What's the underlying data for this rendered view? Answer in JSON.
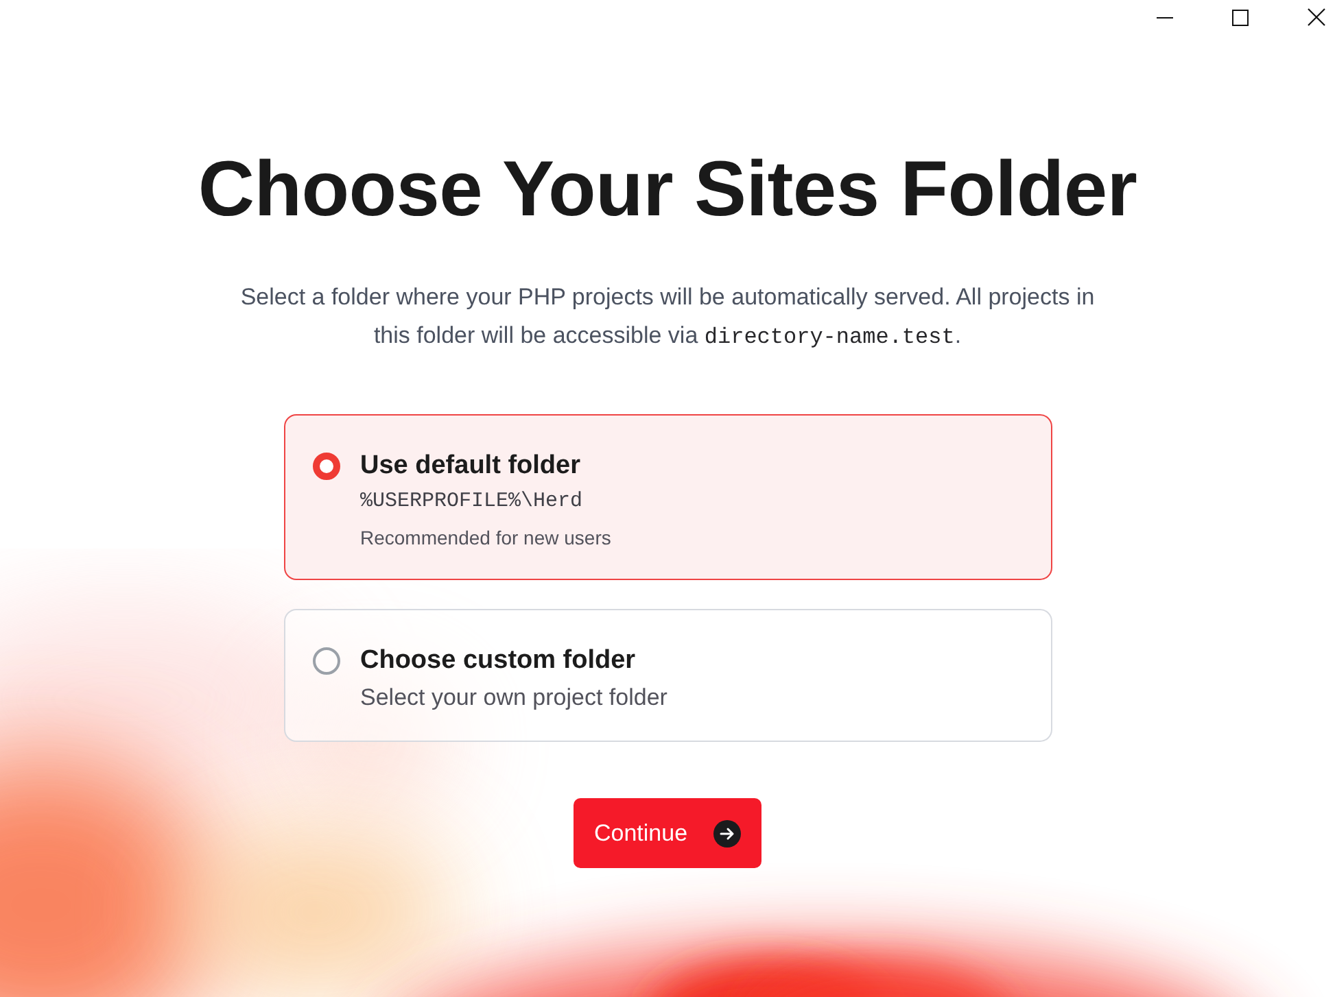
{
  "title": "Choose Your Sites Folder",
  "description": {
    "text": "Select a folder where your PHP projects will be automatically served. All projects in this folder will be accessible via ",
    "code": "directory-name.test",
    "after": "."
  },
  "options": [
    {
      "title": "Use default folder",
      "path": "%USERPROFILE%\\Herd",
      "note": "Recommended for new users",
      "selected": true
    },
    {
      "title": "Choose custom folder",
      "note": "Select your own project folder",
      "selected": false
    }
  ],
  "button": {
    "label": "Continue"
  }
}
